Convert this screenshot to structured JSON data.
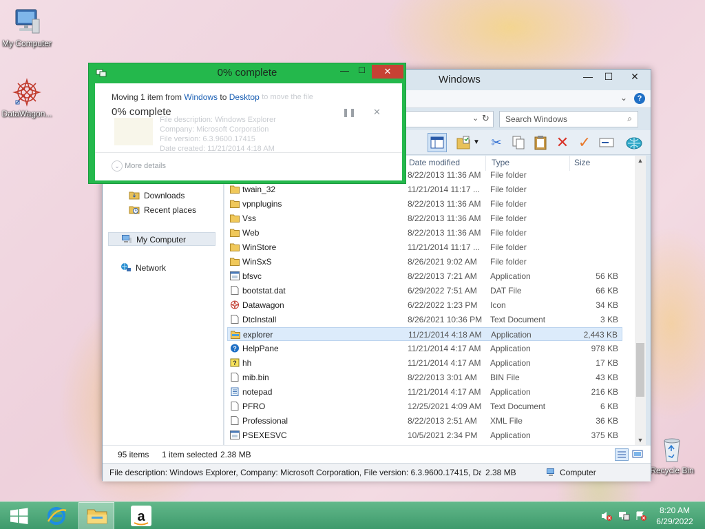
{
  "desktop": {
    "icons": [
      {
        "label": "My Computer"
      },
      {
        "label": "DataWagon..."
      },
      {
        "label": "Recycle Bin"
      }
    ]
  },
  "explorer": {
    "title": "Windows",
    "search_placeholder": "Search Windows",
    "nav": {
      "downloads": "Downloads",
      "recent": "Recent places",
      "my_computer": "My Computer",
      "network": "Network"
    },
    "columns": {
      "date": "Date modified",
      "type": "Type",
      "size": "Size"
    },
    "files": [
      {
        "name": "",
        "date": "8/22/2013 11:36 AM",
        "type": "File folder",
        "size": "",
        "icon": "folder"
      },
      {
        "name": "twain_32",
        "date": "11/21/2014 11:17 ...",
        "type": "File folder",
        "size": "",
        "icon": "folder"
      },
      {
        "name": "vpnplugins",
        "date": "8/22/2013 11:36 AM",
        "type": "File folder",
        "size": "",
        "icon": "folder"
      },
      {
        "name": "Vss",
        "date": "8/22/2013 11:36 AM",
        "type": "File folder",
        "size": "",
        "icon": "folder"
      },
      {
        "name": "Web",
        "date": "8/22/2013 11:36 AM",
        "type": "File folder",
        "size": "",
        "icon": "folder"
      },
      {
        "name": "WinStore",
        "date": "11/21/2014 11:17 ...",
        "type": "File folder",
        "size": "",
        "icon": "folder"
      },
      {
        "name": "WinSxS",
        "date": "8/26/2021 9:02 AM",
        "type": "File folder",
        "size": "",
        "icon": "folder"
      },
      {
        "name": "bfsvc",
        "date": "8/22/2013 7:21 AM",
        "type": "Application",
        "size": "56 KB",
        "icon": "app"
      },
      {
        "name": "bootstat.dat",
        "date": "6/29/2022 7:51 AM",
        "type": "DAT File",
        "size": "66 KB",
        "icon": "doc"
      },
      {
        "name": "Datawagon",
        "date": "6/22/2022 1:23 PM",
        "type": "Icon",
        "size": "34 KB",
        "icon": "star"
      },
      {
        "name": "DtcInstall",
        "date": "8/26/2021 10:36 PM",
        "type": "Text Document",
        "size": "3 KB",
        "icon": "doc"
      },
      {
        "name": "explorer",
        "date": "11/21/2014 4:18 AM",
        "type": "Application",
        "size": "2,443 KB",
        "icon": "explorer",
        "selected": true
      },
      {
        "name": "HelpPane",
        "date": "11/21/2014 4:17 AM",
        "type": "Application",
        "size": "978 KB",
        "icon": "help"
      },
      {
        "name": "hh",
        "date": "11/21/2014 4:17 AM",
        "type": "Application",
        "size": "17 KB",
        "icon": "hh"
      },
      {
        "name": "mib.bin",
        "date": "8/22/2013 3:01 AM",
        "type": "BIN File",
        "size": "43 KB",
        "icon": "doc"
      },
      {
        "name": "notepad",
        "date": "11/21/2014 4:17 AM",
        "type": "Application",
        "size": "216 KB",
        "icon": "notepad"
      },
      {
        "name": "PFRO",
        "date": "12/25/2021 4:09 AM",
        "type": "Text Document",
        "size": "6 KB",
        "icon": "doc"
      },
      {
        "name": "Professional",
        "date": "8/22/2013 2:51 AM",
        "type": "XML File",
        "size": "36 KB",
        "icon": "doc"
      },
      {
        "name": "PSEXESVC",
        "date": "10/5/2021 2:34 PM",
        "type": "Application",
        "size": "375 KB",
        "icon": "app"
      }
    ],
    "status": {
      "count": "95 items",
      "selected": "1 item selected",
      "selected_size": "2.38 MB"
    },
    "details": {
      "description": "File description: Windows Explorer, Company: Microsoft Corporation, File version: 6.3.9600.17415, Date",
      "size": "2.38 MB",
      "location": "Computer"
    }
  },
  "copy_dialog": {
    "title": "0% complete",
    "moving_prefix": "Moving 1 item from ",
    "from": "Windows",
    "to_word": " to ",
    "to": "Desktop",
    "progress_text": "0% complete",
    "progress": 0,
    "more_details": "More details",
    "ghost": {
      "line1": "... to move the file",
      "line2": "File description: Windows Explorer",
      "line3": "Company: Microsoft Corporation",
      "line4": "File version: 6.3.9600.17415",
      "line5": "Date created: 11/21/2014 4:18 AM"
    }
  },
  "taskbar": {
    "time": "8:20 AM",
    "date": "6/29/2022"
  }
}
